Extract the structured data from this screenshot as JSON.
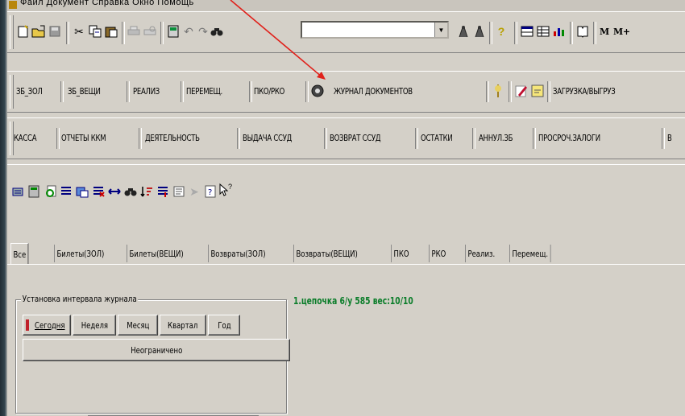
{
  "menubar": {
    "text": "Файл  Документ  Справка  Окно  Помощь"
  },
  "toolbar1": {
    "icons": [
      "new-document-icon",
      "open-folder-icon",
      "save-disk-icon",
      "cut-scissors-icon",
      "copy-icon",
      "paste-icon",
      "print-icon",
      "print-preview-icon",
      "calculator-icon",
      "undo-icon",
      "redo-icon",
      "binoculars-find-icon"
    ],
    "search": {
      "value": "",
      "placeholder": ""
    },
    "right_icons": [
      "find-person-icon",
      "find-person-next-icon",
      "help-question-icon",
      "table-icon",
      "grid-icon",
      "chart-icon",
      "book-icon"
    ],
    "m_label": "M",
    "m_plus_label": "M+"
  },
  "toolbar2": {
    "buttons": [
      "ЗБ_ЗОЛ",
      "ЗБ_ВЕЩИ",
      "РЕАЛИЗ",
      "ПЕРЕМЕЩ.",
      "ПКО/РКО"
    ],
    "journal_label": "ЖУРНАЛ ДОКУМЕНТОВ",
    "load_label": "ЗАГРУЗКА/ВЫГРУЗ"
  },
  "toolbar3": {
    "buttons": [
      "КАССА",
      "ОТЧЕТЫ ККМ",
      "ДЕЯТЕЛЬНОСТЬ",
      "ВЫДАЧА ССУД",
      "ВОЗВРАТ ССУД",
      "ОСТАТКИ",
      "АННУЛ.ЗБ",
      "ПРОСРОЧ.ЗАЛОГИ",
      "В"
    ]
  },
  "tabs": [
    "Все",
    "Билеты(ЗОЛ)",
    "Билеты(ВЕЩИ)",
    "Возвраты(ЗОЛ)",
    "Возвраты(ВЕЩИ)",
    "ПКО",
    "РКО",
    "Реализ.",
    "Перемещ."
  ],
  "interval": {
    "legend": "Установка интервала журнала",
    "today": "Сегодня",
    "week": "Неделя",
    "month": "Месяц",
    "quarter": "Квартал",
    "year": "Год",
    "unlimited": "Неограничено"
  },
  "info_text": "1.цепочка 6/у 585 вес:10/10",
  "colors": {
    "info": "#0b7d2a",
    "arrow": "#e0211b",
    "face": "#d4d0c8"
  }
}
